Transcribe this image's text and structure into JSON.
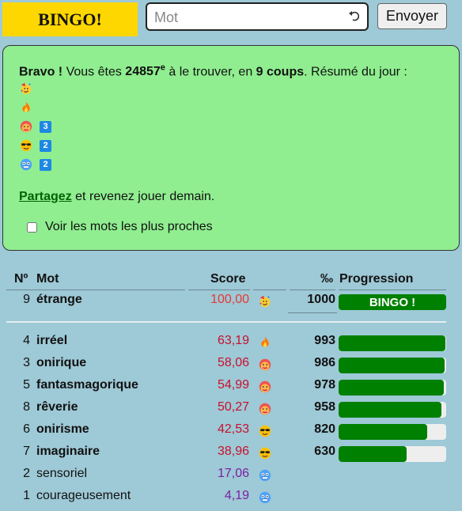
{
  "header": {
    "badge": "BINGO!",
    "input_placeholder": "Mot",
    "send_label": "Envoyer"
  },
  "result": {
    "bravo": "Bravo !",
    "text1": " Vous êtes ",
    "rank": "24857",
    "rank_sup": "e",
    "text2": " à le trouver, en ",
    "tries": "9 coups",
    "text3": ". Résumé du jour :",
    "summary": [
      {
        "icon": "party-face-icon",
        "count": ""
      },
      {
        "icon": "fire-icon",
        "count": ""
      },
      {
        "icon": "hot-face-icon",
        "count": "3"
      },
      {
        "icon": "sunglasses-face-icon",
        "count": "2"
      },
      {
        "icon": "cold-face-icon",
        "count": "2"
      }
    ],
    "share_link": "Partagez",
    "share_rest": " et revenez jouer demain.",
    "closest_label": "Voir les mots les plus proches"
  },
  "table": {
    "headers": {
      "num": "Nº",
      "word": "Mot",
      "score": "Score",
      "permil": "‰",
      "progress": "Progression"
    },
    "winner": {
      "num": "9",
      "word": "étrange",
      "score": "100,00",
      "icon": "party-face-icon",
      "permil": "1000",
      "bar_label": "BINGO !"
    },
    "rows": [
      {
        "num": "4",
        "word": "irréel",
        "score": "63,19",
        "icon": "fire-icon",
        "permil": "993",
        "progress": 0.993,
        "bold": true,
        "score_color": "#c8102e"
      },
      {
        "num": "3",
        "word": "onirique",
        "score": "58,06",
        "icon": "hot-face-icon",
        "permil": "986",
        "progress": 0.986,
        "bold": true,
        "score_color": "#c8102e"
      },
      {
        "num": "5",
        "word": "fantasmagorique",
        "score": "54,99",
        "icon": "hot-face-icon",
        "permil": "978",
        "progress": 0.978,
        "bold": true,
        "score_color": "#c8102e"
      },
      {
        "num": "8",
        "word": "rêverie",
        "score": "50,27",
        "icon": "hot-face-icon",
        "permil": "958",
        "progress": 0.958,
        "bold": true,
        "score_color": "#c8102e"
      },
      {
        "num": "6",
        "word": "onirisme",
        "score": "42,53",
        "icon": "sunglasses-face-icon",
        "permil": "820",
        "progress": 0.82,
        "bold": true,
        "score_color": "#c8102e"
      },
      {
        "num": "7",
        "word": "imaginaire",
        "score": "38,96",
        "icon": "sunglasses-face-icon",
        "permil": "630",
        "progress": 0.63,
        "bold": true,
        "score_color": "#c8102e"
      },
      {
        "num": "2",
        "word": "sensoriel",
        "score": "17,06",
        "icon": "cold-face-icon",
        "permil": "",
        "progress": null,
        "bold": false,
        "score_color": "#7b1fa2"
      },
      {
        "num": "1",
        "word": "courageusement",
        "score": "4,19",
        "icon": "cold-face-icon",
        "permil": "",
        "progress": null,
        "bold": false,
        "score_color": "#7b1fa2"
      }
    ]
  },
  "colors": {
    "badge": "#ffd700",
    "panel": "#90ee90",
    "bar_fill": "#008000",
    "background": "#9ec9d6"
  }
}
